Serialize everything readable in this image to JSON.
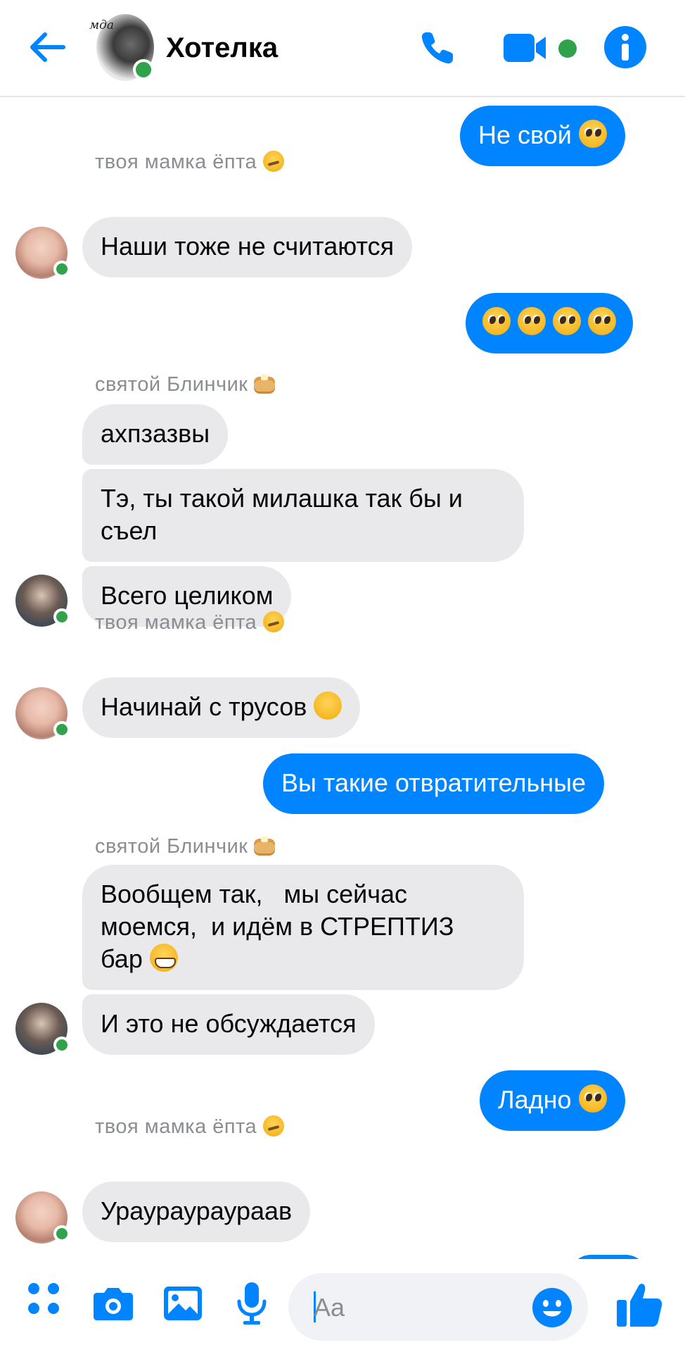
{
  "colors": {
    "accent": "#0084ff",
    "online": "#31a24c",
    "incoming_bubble": "#e9e9eb",
    "sender_text": "#8a8d91"
  },
  "header": {
    "title": "Хотелка",
    "avatar_caption": "мда",
    "icons": [
      "back-arrow-icon",
      "phone-icon",
      "video-camera-icon",
      "info-icon"
    ]
  },
  "messages": [
    {
      "dir": "out",
      "text": "Не свой",
      "emoji": "pleading-face"
    },
    {
      "dir": "in",
      "sender": "твоя мамка ёпта",
      "sender_emoji": "woozy-face",
      "text": "Наши тоже не считаются"
    },
    {
      "dir": "out",
      "text": "",
      "emoji": "pleading-face x4"
    },
    {
      "dir": "in",
      "sender": "святой Блинчик",
      "sender_emoji": "pancakes",
      "text": "ахпзазвы"
    },
    {
      "dir": "in",
      "text": "Тэ, ты такой милашка так бы и съел"
    },
    {
      "dir": "in",
      "text": "Всего целиком"
    },
    {
      "dir": "in",
      "sender": "твоя мамка ёпта",
      "sender_emoji": "woozy-face",
      "text": "Начинай с трусов",
      "emoji": "hand-over-mouth"
    },
    {
      "dir": "out",
      "text": "Вы такие отвратительные"
    },
    {
      "dir": "in",
      "sender": "святой Блинчик",
      "sender_emoji": "pancakes",
      "text_line1": "Вообщем так,   мы сейчас",
      "text_line2": "моемся,  и идём в СТРЕПТИЗ",
      "text_line3": "бар",
      "emoji": "grinning-face"
    },
    {
      "dir": "in",
      "text": "И это не обсуждается"
    },
    {
      "dir": "out",
      "text": "Ладно",
      "emoji": "pleading-face"
    },
    {
      "dir": "in",
      "sender": "твоя мамка ёпта",
      "sender_emoji": "woozy-face",
      "text": "Ураураураураав"
    }
  ],
  "composer": {
    "placeholder": "Aa",
    "icons": [
      "apps-icon",
      "camera-icon",
      "gallery-icon",
      "microphone-icon",
      "emoji-icon",
      "thumbs-up-icon"
    ]
  }
}
